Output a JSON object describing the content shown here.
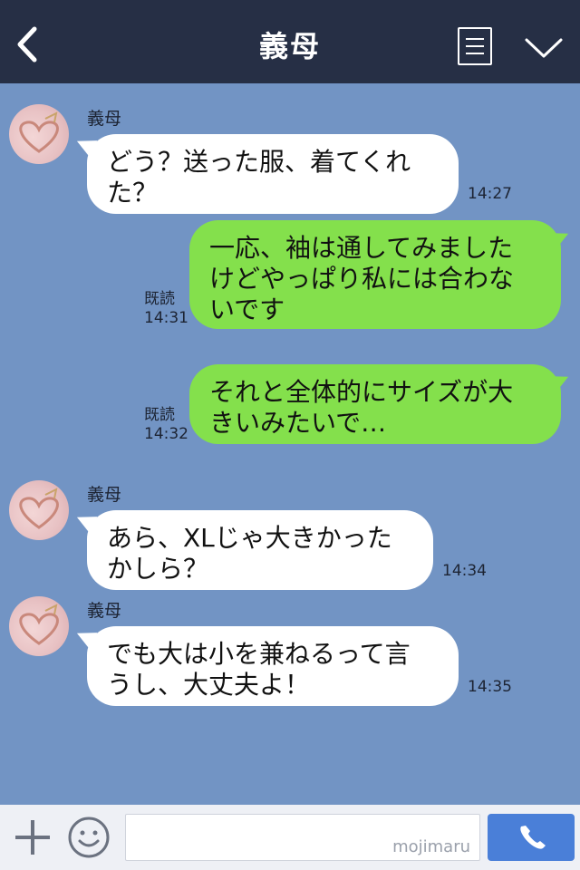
{
  "header": {
    "title": "義母"
  },
  "messages": [
    {
      "type": "in",
      "sender": "義母",
      "lines": [
        "どう？送った服、着てくれ",
        "た？"
      ],
      "time": "14:27"
    },
    {
      "type": "out",
      "lines": [
        "一応、袖は通してみました",
        "けどやっぱり私には合わな",
        "いです"
      ],
      "read": "既読",
      "time": "14:31"
    },
    {
      "type": "out",
      "lines": [
        "それと全体的にサイズが大",
        "きいみたいで…"
      ],
      "read": "既読",
      "time": "14:32"
    },
    {
      "type": "in",
      "sender": "義母",
      "lines": [
        "あら、XLじゃ大きかった",
        "かしら？"
      ],
      "time": "14:34"
    },
    {
      "type": "in",
      "sender": "義母",
      "lines": [
        "でも大は小を兼ねるって言",
        "うし、大丈夫よ！"
      ],
      "time": "14:35"
    }
  ],
  "footer": {
    "watermark": "mojimaru"
  },
  "colors": {
    "header": "#262f45",
    "background": "#7294c4",
    "outgoing": "#84e04c",
    "incoming": "#ffffff",
    "call": "#4a7fd8"
  }
}
